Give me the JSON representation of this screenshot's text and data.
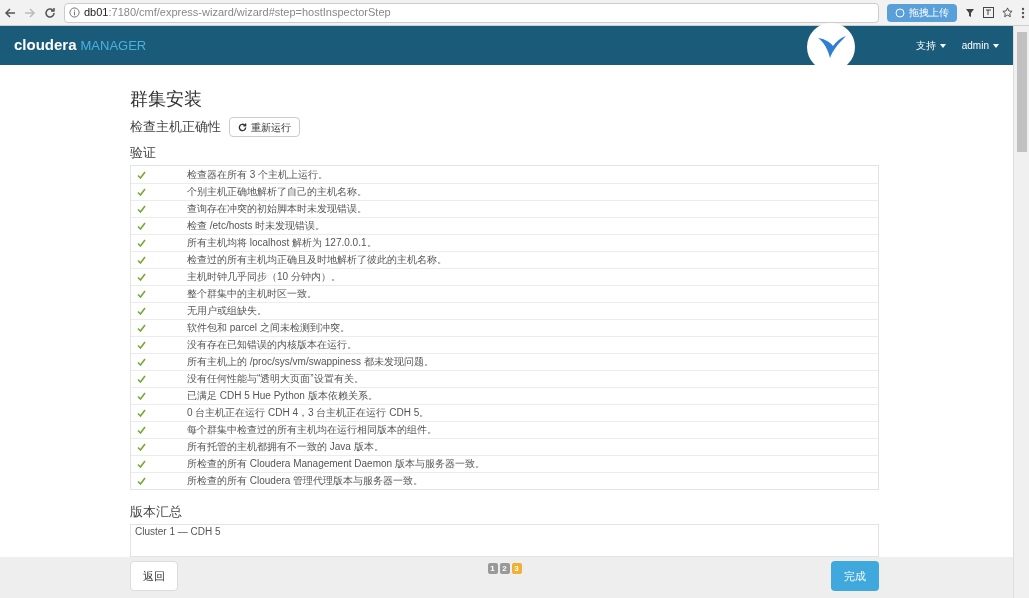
{
  "browser": {
    "url_host": "db01",
    "url_path": ":7180/cmf/express-wizard/wizard#step=hostInspectorStep",
    "extension_button": "拖拽上传"
  },
  "header": {
    "logo_main": "cloudera",
    "logo_sub": "MANAGER",
    "menus": [
      "支持",
      "admin"
    ]
  },
  "title": "群集安装",
  "inspector": {
    "label": "检查主机正确性",
    "rerun_button": "重新运行"
  },
  "validation": {
    "heading": "验证",
    "checks": [
      {
        "passed": true,
        "text": "检查器在所有 3 个主机上运行。"
      },
      {
        "passed": true,
        "text": "个别主机正确地解析了自己的主机名称。"
      },
      {
        "passed": true,
        "text": "查询存在冲突的初始脚本时未发现错误。"
      },
      {
        "passed": true,
        "text": "检查 /etc/hosts 时未发现错误。"
      },
      {
        "passed": true,
        "text": "所有主机均将 localhost 解析为 127.0.0.1。"
      },
      {
        "passed": true,
        "text": "检查过的所有主机均正确且及时地解析了彼此的主机名称。"
      },
      {
        "passed": true,
        "text": "主机时钟几乎同步（10 分钟内）。"
      },
      {
        "passed": true,
        "text": "整个群集中的主机时区一致。"
      },
      {
        "passed": true,
        "text": "无用户或组缺失。"
      },
      {
        "passed": true,
        "text": "软件包和 parcel 之间未检测到冲突。"
      },
      {
        "passed": true,
        "text": "没有存在已知错误的内核版本在运行。"
      },
      {
        "passed": true,
        "text": "所有主机上的 /proc/sys/vm/swappiness 都未发现问题。"
      },
      {
        "passed": true,
        "text": "没有任何性能与“透明大页面”设置有关。"
      },
      {
        "passed": true,
        "text": "已满足 CDH 5 Hue Python 版本依赖关系。"
      },
      {
        "passed": true,
        "text": "0 台主机正在运行 CDH 4，3 台主机正在运行 CDH 5。"
      },
      {
        "passed": true,
        "text": "每个群集中检查过的所有主机均在运行相同版本的组件。"
      },
      {
        "passed": true,
        "text": "所有托管的主机都拥有不一致的 Java 版本。"
      },
      {
        "passed": true,
        "text": "所检查的所有 Cloudera Management Daemon 版本与服务器一致。"
      },
      {
        "passed": true,
        "text": "所检查的所有 Cloudera 管理代理版本与服务器一致。"
      }
    ]
  },
  "version_summary": {
    "heading": "版本汇总",
    "rows": [
      "Cluster 1 — CDH 5"
    ]
  },
  "footer": {
    "back_button": "返回",
    "steps": [
      {
        "label": "1",
        "selected": false
      },
      {
        "label": "2",
        "selected": false
      },
      {
        "label": "3",
        "selected": true
      }
    ],
    "finish_button": "完成"
  }
}
